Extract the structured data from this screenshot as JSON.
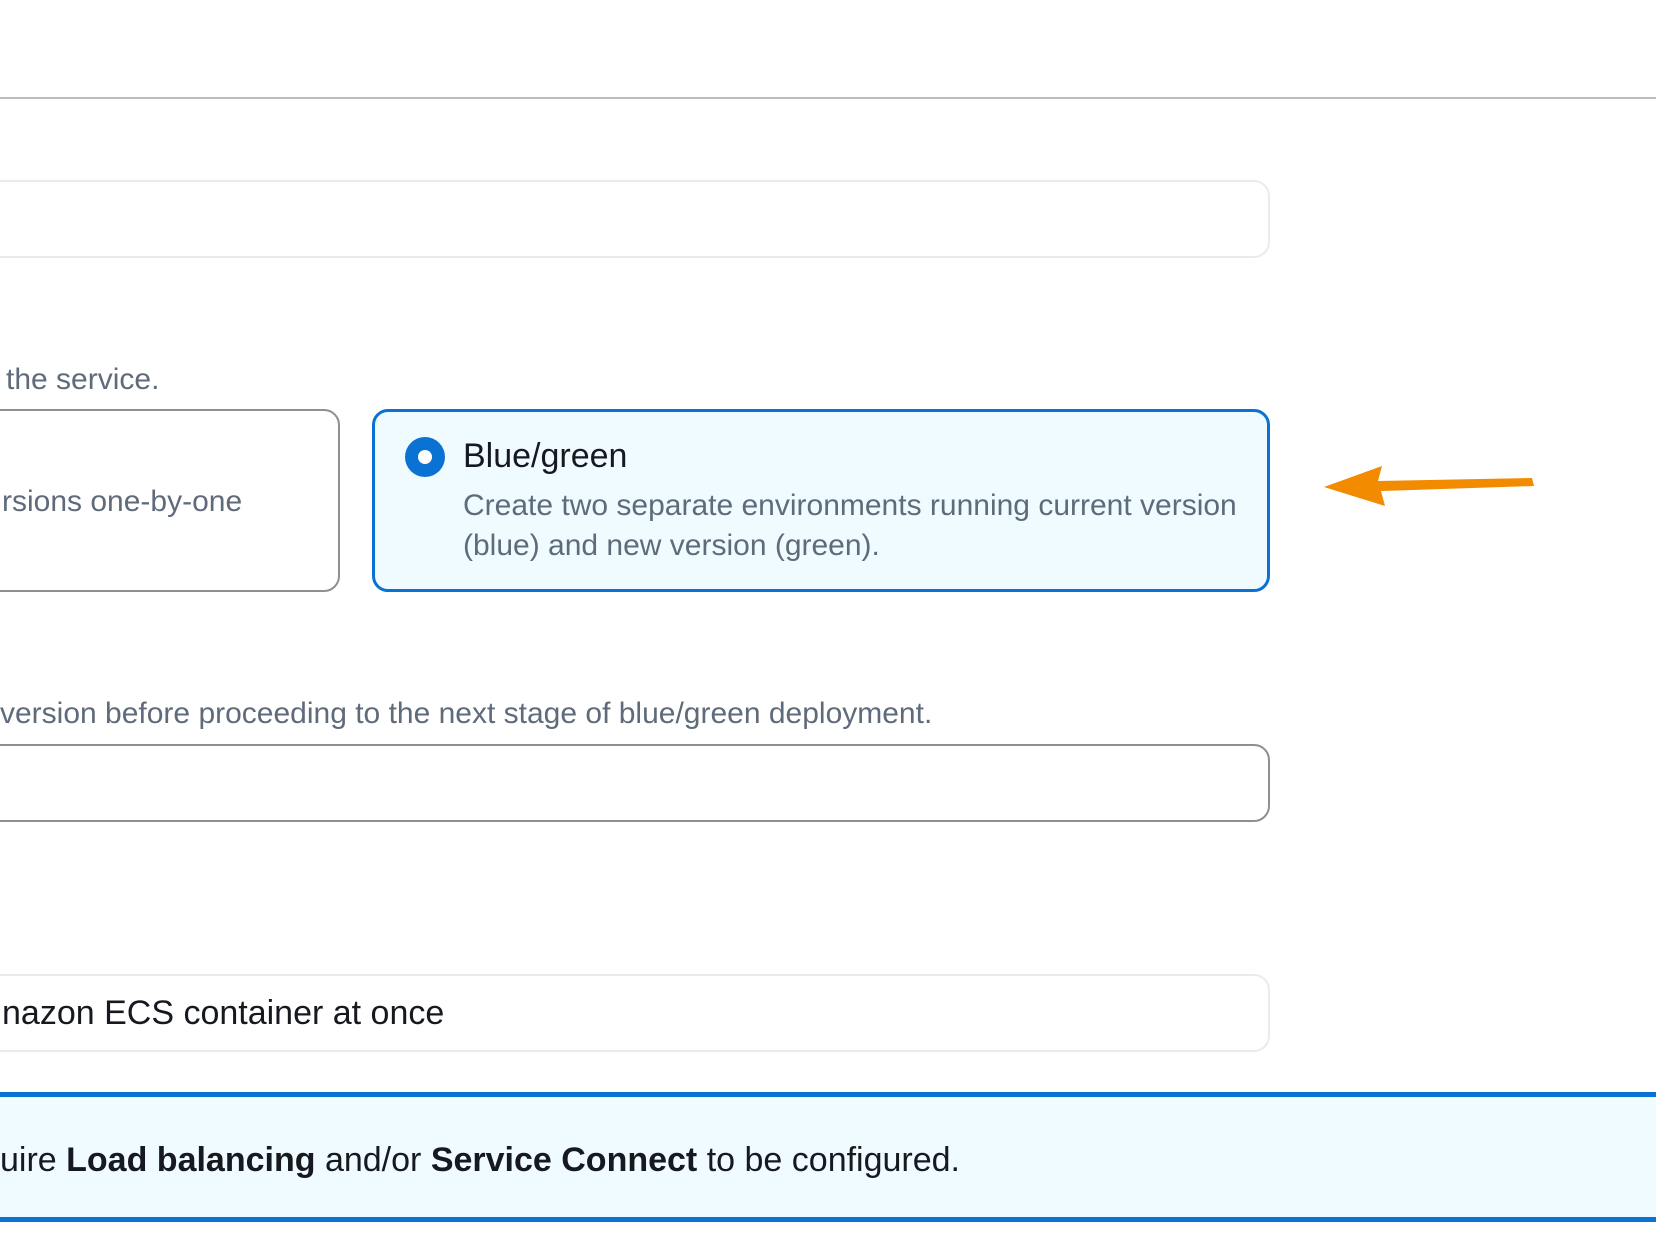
{
  "deployment": {
    "strategy_description_fragment": "the service.",
    "rolling_tile": {
      "description_fragment": "rsions one-by-one"
    },
    "blue_green_tile": {
      "title": "Blue/green",
      "description": "Create two separate environments running current version (blue) and new version (green).",
      "selected": true
    },
    "bake_time_description_fragment": "version before proceeding to the next stage of blue/green deployment.",
    "bake_time_value": "",
    "compatibility_value_fragment": "nazon ECS container at once"
  },
  "info_banner": {
    "prefix": "uire ",
    "bold1": "Load balancing",
    "middle": " and/or ",
    "bold2": "Service Connect",
    "suffix": " to be configured."
  },
  "colors": {
    "accent": "#0972d3",
    "selected_bg": "#f0fbff",
    "annotation_arrow": "#f38b00"
  }
}
